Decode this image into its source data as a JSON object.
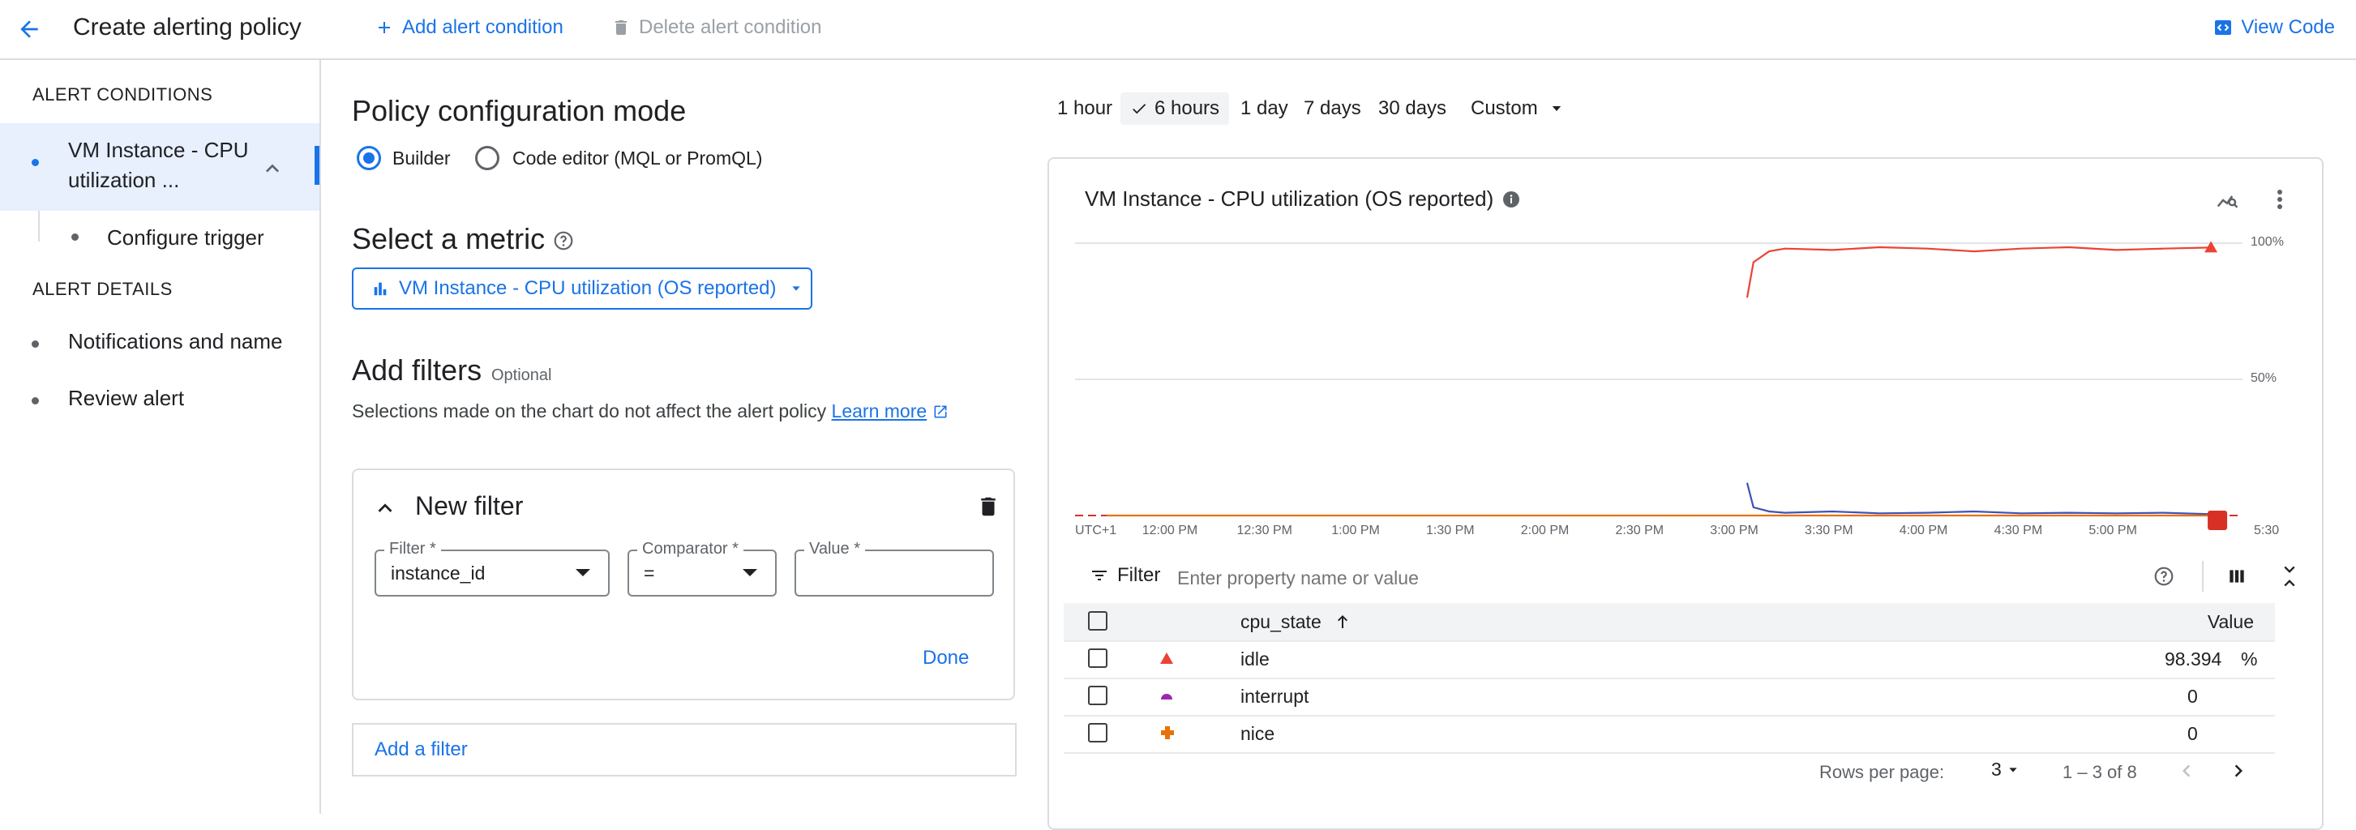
{
  "header": {
    "title": "Create alerting policy",
    "add_condition": "Add alert condition",
    "delete_condition": "Delete alert condition",
    "view_code": "View Code"
  },
  "sidebar": {
    "conditions_heading": "ALERT CONDITIONS",
    "condition_line1": "VM Instance - CPU",
    "condition_line2": "utilization ...",
    "configure_trigger": "Configure trigger",
    "details_heading": "ALERT DETAILS",
    "notifications": "Notifications and name",
    "review": "Review alert"
  },
  "config": {
    "mode_title": "Policy configuration mode",
    "builder_label": "Builder",
    "code_editor_label": "Code editor (MQL or PromQL)",
    "selected_mode": "Builder"
  },
  "metric": {
    "title": "Select a metric",
    "selected": "VM Instance - CPU utilization (OS reported)"
  },
  "filters": {
    "title": "Add filters",
    "optional": "Optional",
    "description": "Selections made on the chart do not affect the alert policy",
    "learn_more": "Learn more",
    "new_filter_title": "New filter",
    "filter_label": "Filter *",
    "filter_value": "instance_id",
    "comparator_label": "Comparator *",
    "comparator_value": "=",
    "value_label": "Value *",
    "value_value": "",
    "done": "Done",
    "add_filter": "Add a filter"
  },
  "time_ranges": {
    "items": [
      "1 hour",
      "6 hours",
      "1 day",
      "7 days",
      "30 days"
    ],
    "selected": "6 hours",
    "custom": "Custom"
  },
  "chart": {
    "title": "VM Instance - CPU utilization (OS reported)",
    "timezone": "UTC+1",
    "filter_label": "Filter",
    "filter_placeholder": "Enter property name or value"
  },
  "chart_data": {
    "type": "line",
    "title": "VM Instance - CPU utilization (OS reported)",
    "x_ticks": [
      "UTC+1",
      "12:00 PM",
      "12:30 PM",
      "1:00 PM",
      "1:30 PM",
      "2:00 PM",
      "2:30 PM",
      "3:00 PM",
      "3:30 PM",
      "4:00 PM",
      "4:30 PM",
      "5:00 PM",
      "5:30"
    ],
    "y_ticks": [
      "100%",
      "50%"
    ],
    "y_unit": "%",
    "ylim": [
      0,
      100
    ],
    "threshold_value": 0,
    "threshold_color": "#d93025",
    "series": [
      {
        "name": "idle",
        "color": "#ea4335",
        "x": [
          "3:03 PM",
          "3:05 PM",
          "3:10 PM",
          "3:15 PM",
          "3:30 PM",
          "3:45 PM",
          "4:00 PM",
          "4:15 PM",
          "4:30 PM",
          "4:45 PM",
          "5:00 PM",
          "5:15 PM",
          "5:30 PM"
        ],
        "values": [
          80,
          93,
          97,
          98,
          97.5,
          98.5,
          98,
          97,
          98,
          98.5,
          97.5,
          98,
          98.4
        ]
      },
      {
        "name": "interrupt",
        "color": "#3f51b5",
        "x": [
          "3:03 PM",
          "3:05 PM",
          "3:10 PM",
          "3:15 PM",
          "3:30 PM",
          "3:45 PM",
          "4:00 PM",
          "4:15 PM",
          "4:30 PM",
          "4:45 PM",
          "5:00 PM",
          "5:15 PM",
          "5:30 PM"
        ],
        "values": [
          12,
          3,
          1.5,
          1,
          1.5,
          0.8,
          1,
          1.5,
          0.8,
          1,
          0.8,
          1,
          0.5
        ]
      },
      {
        "name": "nice",
        "color": "#e8710a",
        "x": [
          "11:40 AM",
          "5:30 PM"
        ],
        "values": [
          0,
          0
        ]
      }
    ]
  },
  "table": {
    "col_state": "cpu_state",
    "col_value": "Value",
    "rows": [
      {
        "state": "idle",
        "value": "98.394",
        "unit": "%",
        "marker_color": "#ea4335"
      },
      {
        "state": "interrupt",
        "value": "0",
        "unit": "",
        "marker_color": "#9c27b0"
      },
      {
        "state": "nice",
        "value": "0",
        "unit": "",
        "marker_color": "#e8710a"
      }
    ],
    "rows_per_page_label": "Rows per page:",
    "rows_per_page": "3",
    "range_text": "1 – 3 of 8"
  },
  "colors": {
    "accent": "#1a73e8",
    "text": "#202124",
    "muted": "#5f6368",
    "border": "#dadce0"
  }
}
